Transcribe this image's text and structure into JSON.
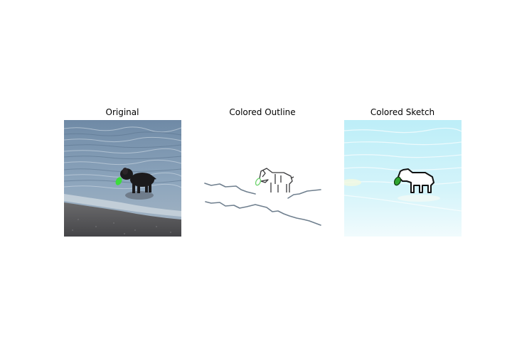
{
  "panels": [
    {
      "title": "Original"
    },
    {
      "title": "Colored Outline"
    },
    {
      "title": "Colored Sketch"
    }
  ],
  "colors": {
    "background": "#ffffff",
    "water": "#8aa3bb",
    "sand": "#55565a",
    "dog": "#1b1a1c",
    "toy": "#3ddc3d",
    "outline_stroke": "#6f7f8e",
    "sketch_background": "#c9f1f8"
  }
}
